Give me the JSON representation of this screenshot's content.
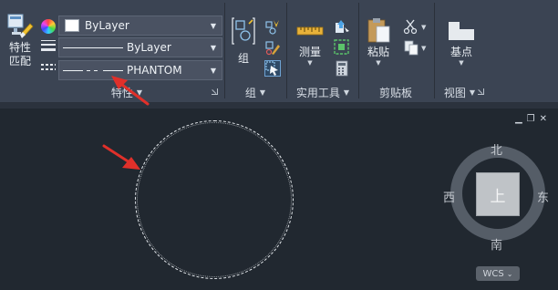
{
  "properties_panel": {
    "match_button_label": "特性\n匹配",
    "color_value": "ByLayer",
    "lineweight_value": "ByLayer",
    "linetype_value": "PHANTOM",
    "footer_label": "特性"
  },
  "group_panel": {
    "group_button_label": "组",
    "footer_label": "组"
  },
  "utilities_panel": {
    "measure_button_label": "测量",
    "footer_label": "实用工具"
  },
  "clipboard_panel": {
    "paste_button_label": "粘贴",
    "footer_label": "剪贴板"
  },
  "view_panel": {
    "base_button_label": "基点",
    "footer_label": "视图"
  },
  "viewcube": {
    "north": "北",
    "south": "南",
    "west": "西",
    "east": "东",
    "top_face": "上",
    "wcs_label": "WCS"
  },
  "colors": {
    "ribbon_bg": "#3b4453",
    "canvas_bg": "#212830",
    "annotation_arrow": "#e0302a"
  }
}
